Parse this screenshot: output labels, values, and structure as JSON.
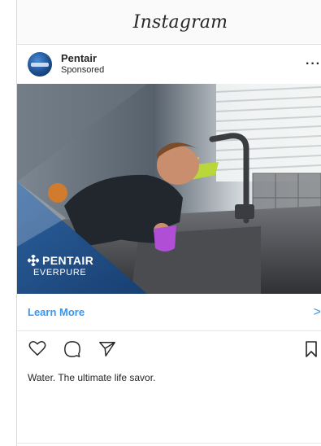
{
  "app": {
    "title": "Instagram"
  },
  "post": {
    "username": "Pentair",
    "label": "Sponsored",
    "more_glyph": "···",
    "image_brand": {
      "name": "PENTAIR",
      "sub": "EVERPURE"
    },
    "cta": {
      "label": "Learn More",
      "arrow": ">"
    },
    "caption": "Water. The ultimate life savor."
  },
  "icons": {
    "like": "heart-icon",
    "comment": "comment-bubble-icon",
    "share": "paper-plane-icon",
    "save": "bookmark-icon"
  },
  "colors": {
    "link_blue": "#3897f0",
    "brand_navy": "#1f4f8a",
    "text": "#262626"
  }
}
